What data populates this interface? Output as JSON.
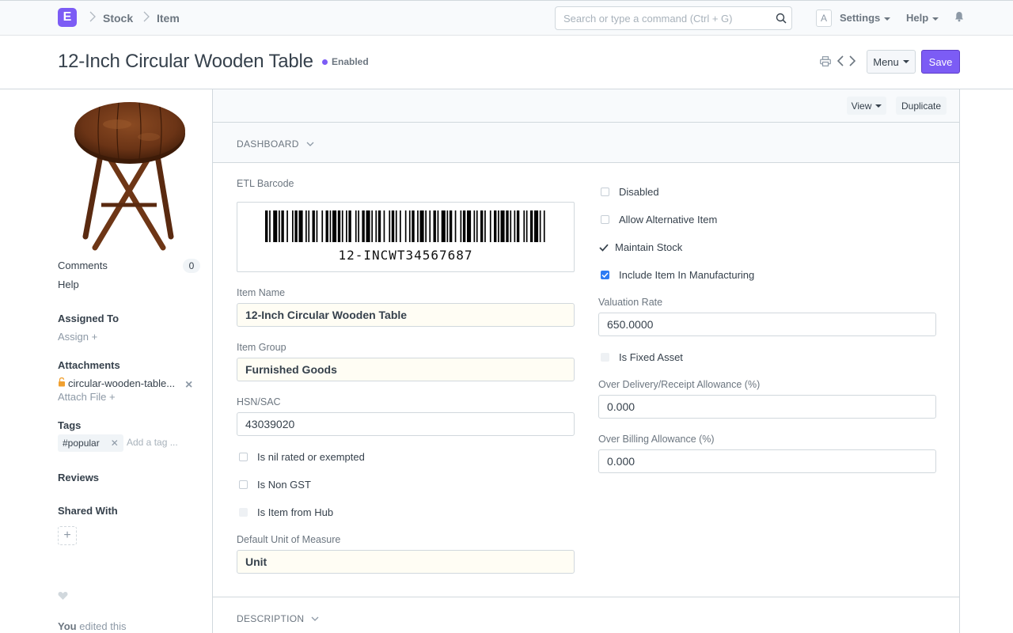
{
  "app": {
    "logo_letter": "E",
    "brand_color": "#7c5cf5"
  },
  "breadcrumbs": [
    "Stock",
    "Item"
  ],
  "search": {
    "placeholder": "Search or type a command (Ctrl + G)"
  },
  "nav": {
    "avatar_letter": "A",
    "settings": "Settings",
    "help": "Help"
  },
  "page": {
    "title": "12-Inch Circular Wooden Table",
    "status": "Enabled",
    "status_color": "#7c5cf5",
    "menu_label": "Menu",
    "save_label": "Save"
  },
  "sidebar": {
    "comments_label": "Comments",
    "comments_count": "0",
    "help_label": "Help",
    "assigned_to_label": "Assigned To",
    "assign_label": "Assign",
    "attachments_label": "Attachments",
    "attachment_file": "circular-wooden-table...",
    "attach_file_label": "Attach File",
    "tags_label": "Tags",
    "tag": "#popular",
    "add_tag_placeholder": "Add a tag ...",
    "reviews_label": "Reviews",
    "shared_with_label": "Shared With",
    "activity_user": "You",
    "activity_text": "edited this"
  },
  "toolbar": {
    "view_label": "View",
    "duplicate_label": "Duplicate"
  },
  "sections": {
    "dashboard": "DASHBOARD",
    "description": "DESCRIPTION"
  },
  "form": {
    "barcode_label": "ETL Barcode",
    "barcode_value": "12-INCWT34567687",
    "item_name_label": "Item Name",
    "item_name": "12-Inch Circular Wooden Table",
    "item_group_label": "Item Group",
    "item_group": "Furnished Goods",
    "hsn_label": "HSN/SAC",
    "hsn": "43039020",
    "nil_rated_label": "Is nil rated or exempted",
    "non_gst_label": "Is Non GST",
    "from_hub_label": "Is Item from Hub",
    "uom_label": "Default Unit of Measure",
    "uom": "Unit",
    "disabled_label": "Disabled",
    "alt_item_label": "Allow Alternative Item",
    "maintain_stock_label": "Maintain Stock",
    "manufacturing_label": "Include Item In Manufacturing",
    "valuation_rate_label": "Valuation Rate",
    "valuation_rate": "650.0000",
    "fixed_asset_label": "Is Fixed Asset",
    "over_delivery_label": "Over Delivery/Receipt Allowance (%)",
    "over_delivery": "0.000",
    "over_billing_label": "Over Billing Allowance (%)",
    "over_billing": "0.000"
  },
  "checkbox_states": {
    "nil_rated": false,
    "non_gst": false,
    "from_hub": false,
    "disabled": false,
    "alt_item": false,
    "maintain_stock": true,
    "manufacturing": true,
    "fixed_asset": false
  }
}
